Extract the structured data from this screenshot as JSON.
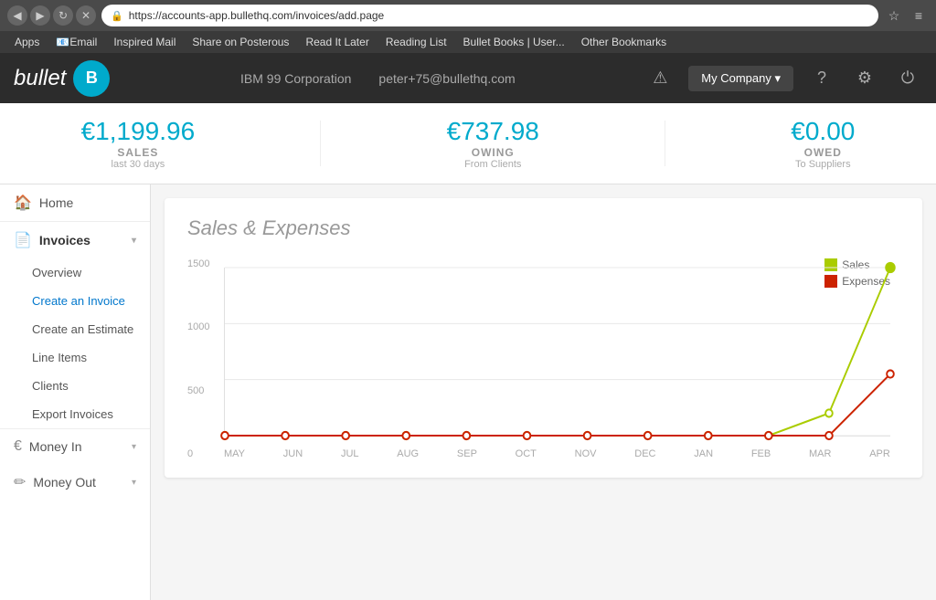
{
  "browser": {
    "url": "https://accounts-app.bullethq.com/invoices/add.page",
    "nav": {
      "back": "◀",
      "forward": "▶",
      "refresh": "↻",
      "close": "✕"
    },
    "bookmarks": [
      {
        "label": "Apps",
        "icon": "grid"
      },
      {
        "label": "Email",
        "icon": "email"
      },
      {
        "label": "Inspired Mail",
        "icon": "mail"
      },
      {
        "label": "Share on Posterous",
        "icon": "share"
      },
      {
        "label": "Read It Later",
        "icon": "read"
      },
      {
        "label": "Reading List",
        "icon": "list"
      },
      {
        "label": "Bullet Books | User...",
        "icon": "bullet"
      },
      {
        "label": "Other Bookmarks",
        "icon": "folder"
      }
    ]
  },
  "header": {
    "logo_text": "bullet",
    "logo_letter": "B",
    "company_name": "IBM 99 Corporation",
    "user_email": "peter+75@bullethq.com",
    "my_company_label": "My Company ▾",
    "icons": {
      "warning": "⚠",
      "help": "?",
      "settings": "⚙",
      "power": "⏻"
    }
  },
  "stats": [
    {
      "amount": "€1,199.96",
      "label": "SALES",
      "sub": "last 30 days"
    },
    {
      "amount": "€737.98",
      "label": "OWING",
      "sub": "From Clients"
    },
    {
      "amount": "€0.00",
      "label": "OWED",
      "sub": "To Suppliers"
    }
  ],
  "sidebar": {
    "home_label": "Home",
    "invoices_label": "Invoices",
    "menu_items": [
      {
        "label": "Overview",
        "link": true
      },
      {
        "label": "Create an Invoice",
        "link": true,
        "highlighted": true
      },
      {
        "label": "Create an Estimate",
        "link": true
      },
      {
        "label": "Line Items",
        "link": true
      },
      {
        "label": "Clients",
        "link": true
      },
      {
        "label": "Export Invoices",
        "link": true
      }
    ],
    "money_in_label": "Money In",
    "money_out_label": "Money Out"
  },
  "chart": {
    "title": "Sales & Expenses",
    "y_labels": [
      "1500",
      "1000",
      "500",
      "0"
    ],
    "x_labels": [
      "MAY",
      "JUN",
      "JUL",
      "AUG",
      "SEP",
      "OCT",
      "NOV",
      "DEC",
      "JAN",
      "FEB",
      "MAR",
      "APR"
    ],
    "legend": [
      {
        "label": "Sales",
        "color": "#aacc00"
      },
      {
        "label": "Expenses",
        "color": "#cc2200"
      }
    ],
    "sales_data": [
      0,
      0,
      0,
      0,
      0,
      0,
      0,
      0,
      0,
      0,
      200,
      1500
    ],
    "expenses_data": [
      0,
      0,
      0,
      0,
      0,
      0,
      0,
      0,
      0,
      0,
      0,
      550
    ]
  }
}
